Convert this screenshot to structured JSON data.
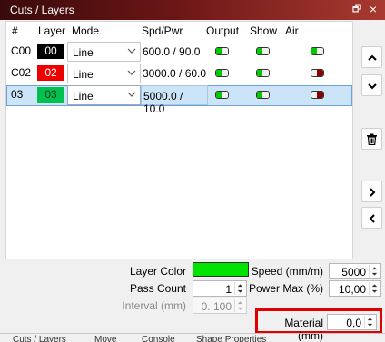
{
  "window": {
    "title": "Cuts / Layers",
    "float_glyph": "🗗",
    "close_glyph": "×"
  },
  "table": {
    "headers": [
      "#",
      "Layer",
      "Mode",
      "Spd/Pwr",
      "Output",
      "Show",
      "Air"
    ],
    "rows": [
      {
        "num": "C00",
        "layer": "00",
        "layer_color": "#000000",
        "layer_text_color": "#ffffff",
        "mode": "Line",
        "spd_pwr": "600.0 / 90.0",
        "output": "on",
        "show": "on",
        "air": "on"
      },
      {
        "num": "C02",
        "layer": "02",
        "layer_color": "#ee0000",
        "layer_text_color": "#ffffff",
        "mode": "Line",
        "spd_pwr": "3000.0 / 60.0",
        "output": "on",
        "show": "on",
        "air": "off"
      },
      {
        "num": "03",
        "layer": "03",
        "layer_color": "#00c050",
        "layer_text_color": "#1a3a1a",
        "mode": "Line",
        "spd_pwr": "5000.0 / 10.0",
        "output": "on",
        "show": "on",
        "air": "off",
        "selected": true
      }
    ]
  },
  "colors": {
    "toggle_on": "#00c800",
    "toggle_off": "#8b0000",
    "toggle_neutral": "#f0f0f0",
    "accent_red": "#e00000"
  },
  "sidebar": {
    "buttons": [
      "move-up",
      "move-down",
      "delete",
      "expand",
      "collapse"
    ]
  },
  "settings": {
    "layer_color_label": "Layer Color",
    "layer_color_value": "#00e400",
    "pass_count_label": "Pass Count",
    "pass_count_value": "1",
    "interval_label": "Interval (mm)",
    "interval_value": "0. 100",
    "speed_label": "Speed (mm/m)",
    "speed_value": "5000",
    "power_max_label": "Power Max (%)",
    "power_max_value": "10,00",
    "material_label": "Material (mm)",
    "material_value": "0,0"
  },
  "bottom_tabs": [
    "Cuts / Layers",
    "Move",
    "Console",
    "Shape Properties"
  ]
}
